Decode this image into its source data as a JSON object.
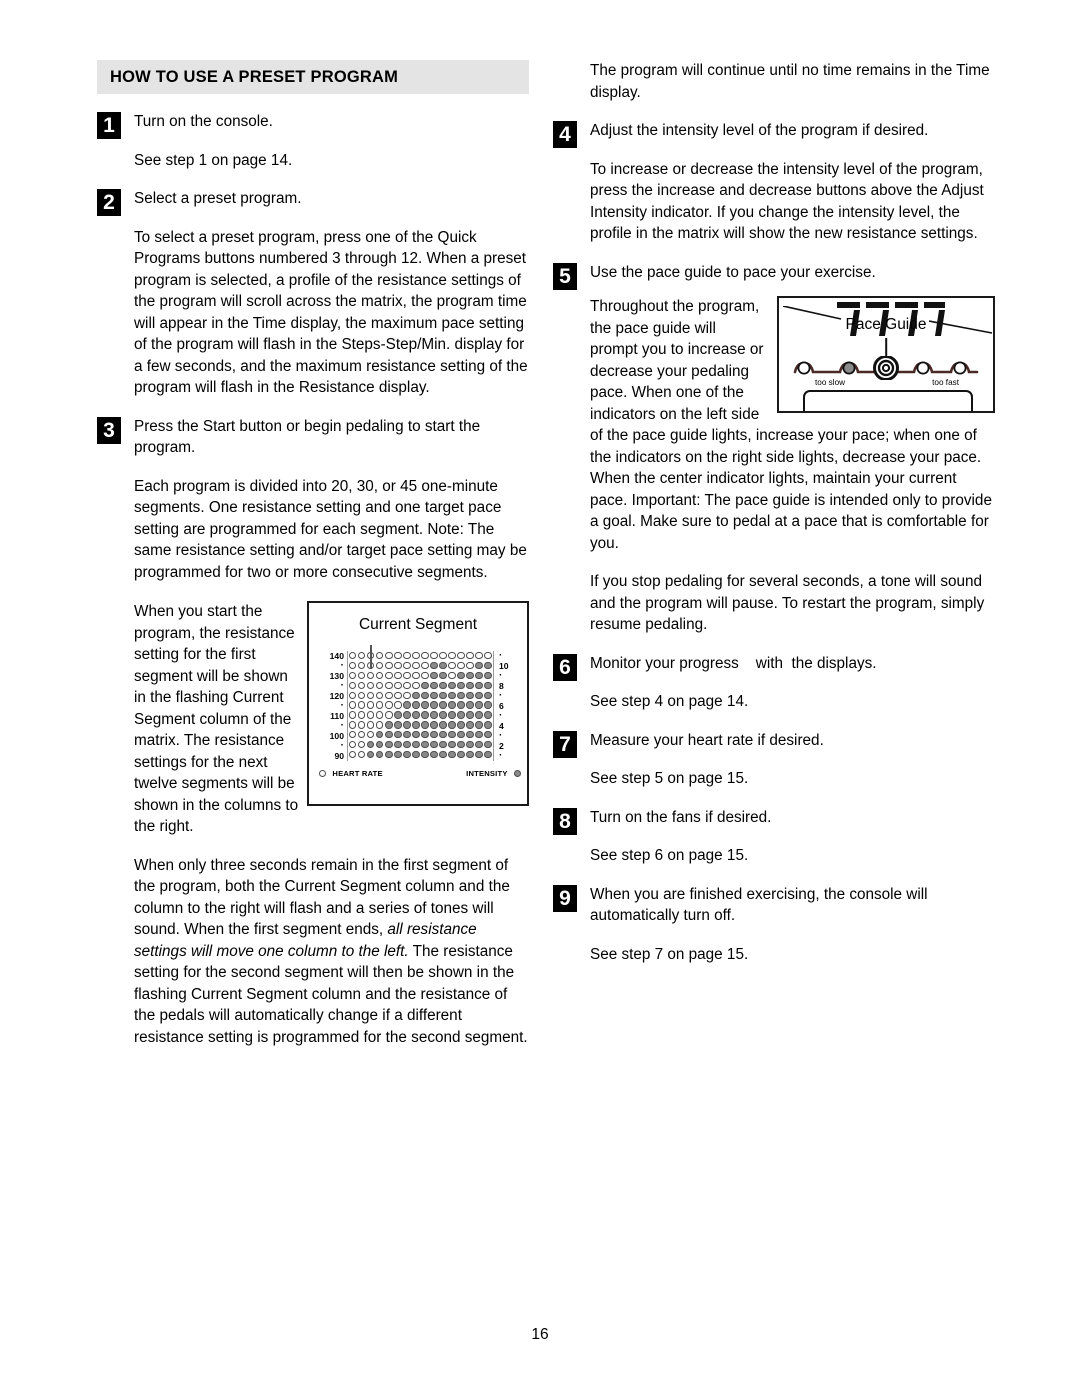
{
  "document": {
    "section_title": "HOW TO USE A PRESET PROGRAM",
    "page_number": "16"
  },
  "left_column": {
    "step1": {
      "number": "1",
      "text": "Turn on the console.",
      "followup": "See step 1 on page 14."
    },
    "step2": {
      "number": "2",
      "text": "Select a preset program.",
      "followup": "To select a preset program, press one of the Quick Programs buttons numbered 3 through 12. When a preset program is selected, a profile of the resistance settings of the program will scroll across the matrix, the program time will appear in the Time display, the maximum pace setting of the program will flash in the Steps-Step/Min. display for a few seconds, and the maximum resistance setting of the program will flash in the Resistance display."
    },
    "step3": {
      "number": "3",
      "text": "Press the Start button or begin pedaling to start the program.",
      "para1": "Each program is divided into 20, 30, or 45 one-minute segments. One resistance setting and one target pace setting are programmed for each segment. Note: The same resistance setting and/or target pace setting may be programmed for two or more consecutive segments.",
      "para2": "When you start the program, the resistance setting for the first segment will be shown in the flashing Current Segment column of the matrix. The resistance settings for the next twelve segments will be shown in the columns to the right.",
      "para3_a": "When only three seconds remain in the first segment of the program, both the Current Segment column and the column to the right will flash and a series of tones will sound. When the first segment ends, ",
      "para3_italic": "all resistance settings will move one column to the left.",
      "para3_b": " The resistance setting for the second segment will then be shown in the flashing Current Segment column and the resistance of the pedals will automatically change if a different resistance setting is programmed for the second segment."
    }
  },
  "right_column": {
    "intro": "The program will continue until no time remains in the Time display.",
    "step4": {
      "number": "4",
      "text": "Adjust the intensity level of the program if desired.",
      "followup": "To increase or decrease the intensity level of the program, press the increase and decrease buttons above the Adjust Intensity indicator. If you change the intensity level, the profile in the matrix will show the new resistance settings."
    },
    "step5": {
      "number": "5",
      "text": "Use the pace guide to pace your exercise.",
      "para1": "Throughout the program, the pace guide will prompt you to increase or decrease your pedaling pace. When one of the indicators on the left side of the pace guide lights, increase your pace; when one of the indicators on the right side lights, decrease your pace. When the center indicator lights, maintain your current pace. Important: The pace guide is intended only to provide a goal. Make sure to pedal at a pace that is comfortable for you.",
      "para2": "If you stop pedaling for several seconds, a tone will sound and the program will pause. To restart the program, simply resume pedaling."
    },
    "step6": {
      "number": "6",
      "text": "Monitor your progress    with  the displays.",
      "followup": "See step 4 on page 14."
    },
    "step7": {
      "number": "7",
      "text": "Measure your heart rate if desired.",
      "followup": "See step 5 on page 15."
    },
    "step8": {
      "number": "8",
      "text": "Turn on the fans if desired.",
      "followup": "See step 6 on page 15."
    },
    "step9": {
      "number": "9",
      "text": "When you are finished exercising, the console will automatically turn off.",
      "followup": "See step 7 on page 15."
    }
  },
  "figures": {
    "current_segment": {
      "caption": "Current Segment",
      "left_axis": [
        "140",
        "·",
        "130",
        "·",
        "120",
        "·",
        "110",
        "·",
        "100",
        "·",
        "90"
      ],
      "right_axis": [
        "·",
        "10",
        "·",
        "8",
        "·",
        "6",
        "·",
        "4",
        "·",
        "2",
        "·"
      ],
      "legend_heart_rate": "HEART RATE",
      "legend_intensity": "INTENSITY",
      "columns": 16,
      "rows": 11,
      "dot_open_color": "#ffffff",
      "dot_filled_color": "#8a8a8a",
      "matrix": [
        [
          0,
          0,
          0,
          0,
          0,
          0,
          0,
          0,
          0,
          0,
          0,
          0,
          0,
          0,
          0,
          0
        ],
        [
          0,
          0,
          0,
          0,
          0,
          0,
          0,
          0,
          0,
          1,
          1,
          0,
          0,
          0,
          1,
          1
        ],
        [
          0,
          0,
          0,
          0,
          0,
          0,
          0,
          0,
          0,
          1,
          1,
          0,
          1,
          1,
          1,
          1
        ],
        [
          0,
          0,
          0,
          0,
          0,
          0,
          0,
          0,
          1,
          1,
          1,
          1,
          1,
          1,
          1,
          1
        ],
        [
          0,
          0,
          0,
          0,
          0,
          0,
          0,
          1,
          1,
          1,
          1,
          1,
          1,
          1,
          1,
          1
        ],
        [
          0,
          0,
          0,
          0,
          0,
          0,
          1,
          1,
          1,
          1,
          1,
          1,
          1,
          1,
          1,
          1
        ],
        [
          0,
          0,
          0,
          0,
          0,
          1,
          1,
          1,
          1,
          1,
          1,
          1,
          1,
          1,
          1,
          1
        ],
        [
          0,
          0,
          0,
          0,
          1,
          1,
          1,
          1,
          1,
          1,
          1,
          1,
          1,
          1,
          1,
          1
        ],
        [
          0,
          0,
          0,
          1,
          1,
          1,
          1,
          1,
          1,
          1,
          1,
          1,
          1,
          1,
          1,
          1
        ],
        [
          0,
          0,
          1,
          1,
          1,
          1,
          1,
          1,
          1,
          1,
          1,
          1,
          1,
          1,
          1,
          1
        ],
        [
          0,
          0,
          1,
          1,
          1,
          1,
          1,
          1,
          1,
          1,
          1,
          1,
          1,
          1,
          1,
          1
        ]
      ]
    },
    "pace_guide": {
      "caption": "Pace Guide",
      "label_too_slow": "too slow",
      "label_too_fast": "too fast",
      "indicators": [
        {
          "state": "off"
        },
        {
          "state": "on"
        },
        {
          "state": "center"
        },
        {
          "state": "off"
        },
        {
          "state": "off"
        }
      ]
    }
  }
}
